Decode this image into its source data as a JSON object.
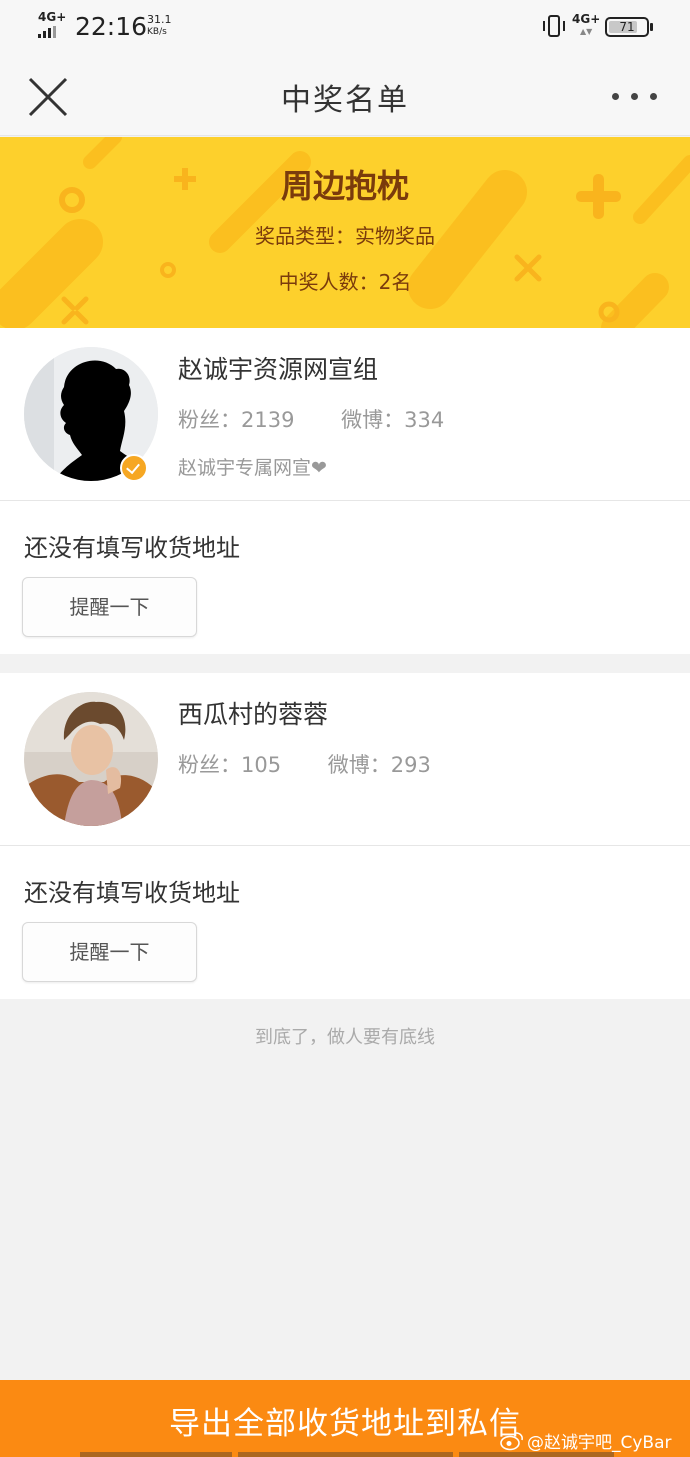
{
  "status_bar": {
    "network_left": "4G+",
    "time": "22:16",
    "speed_value": "31.1",
    "speed_unit": "KB/s",
    "network_right": "4G+",
    "battery": "71"
  },
  "nav": {
    "title": "中奖名单",
    "close_icon": "close-icon",
    "more_icon": "more-icon"
  },
  "banner": {
    "prize_name": "周边抱枕",
    "prize_type": "奖品类型：实物奖品",
    "winner_count": "中奖人数：2名",
    "colors": {
      "background": "#fdd02c",
      "text": "#7a3b0c"
    }
  },
  "winners": [
    {
      "name": "赵诚宇资源网宣组",
      "fans": "粉丝：2139",
      "weibo": "微博：334",
      "bio": "赵诚宇专属网宣❤",
      "verified": true,
      "address_status": "还没有填写收货地址",
      "remind_label": "提醒一下"
    },
    {
      "name": "西瓜村的蓉蓉",
      "fans": "粉丝：105",
      "weibo": "微博：293",
      "address_status": "还没有填写收货地址",
      "remind_label": "提醒一下"
    }
  ],
  "footer_tip": "到底了，做人要有底线",
  "export_button": {
    "label": "导出全部收货地址到私信",
    "color": "#fb8a12"
  },
  "watermark": "@赵诚宇吧_CyBar"
}
